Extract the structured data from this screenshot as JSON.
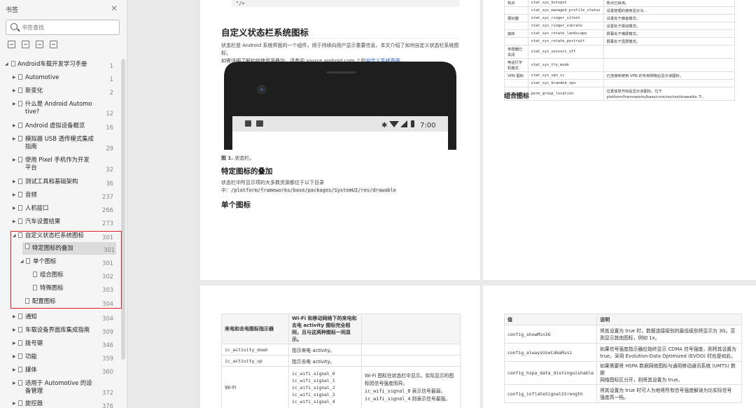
{
  "sidebar": {
    "title": "书签",
    "search_placeholder": "书签查找",
    "tree": [
      {
        "label": "Android车载开发学习手册",
        "page": "1"
      },
      {
        "label": "Automotive",
        "page": "1"
      },
      {
        "label": "新变化",
        "page": "2"
      },
      {
        "label": "什么是 Android Automo",
        "label2": "tive?",
        "page": "12"
      },
      {
        "label": "Android 虚拟设备概览",
        "page": "16"
      },
      {
        "label": "模拟器 USB 透传模式集成",
        "label2": "指南",
        "page": "29"
      },
      {
        "label": "使用 Pixel 手机作为开发",
        "label2": "平台",
        "page": "32"
      },
      {
        "label": "测试工具和基础架构",
        "page": "36"
      },
      {
        "label": "音频",
        "page": "237"
      },
      {
        "label": "人机接口",
        "page": "266"
      },
      {
        "label": "汽车设置结果",
        "page": "273"
      },
      {
        "label": "自定义状态栏系统图标",
        "page": "301"
      },
      {
        "label": "特定图标的叠加",
        "page": "301"
      },
      {
        "label": "单个图标",
        "page": "301"
      },
      {
        "label": "组合图标",
        "page": "302"
      },
      {
        "label": "特殊图标",
        "page": "303"
      },
      {
        "label": "配置图标",
        "page": "304"
      },
      {
        "label": "通知",
        "page": "304"
      },
      {
        "label": "车载设备界面库集成指南",
        "page": "309"
      },
      {
        "label": "拨号键",
        "page": "346"
      },
      {
        "label": "功能",
        "page": "359"
      },
      {
        "label": "媒体",
        "page": "360"
      },
      {
        "label": "适用于 Automotive 的设",
        "label2": "备管理",
        "page": "372"
      },
      {
        "label": "旋控器",
        "page": "376"
      }
    ]
  },
  "page1": {
    "code": "\"/>",
    "heading": "自定义状态栏系统图标",
    "intro1": "状态栏是 Android 系统界面的一个组件，用于持续向用户显示重要信息。本文介绍了如何自定义状态栏系统图标。",
    "intro2a": "如需详细了解如何使资源叠加，请参阅 source.android.com 上的",
    "intro2link": "自定义系统界面",
    "intro2b": "。",
    "status_time": "7:00",
    "caption_bold": "图 1.",
    "caption": " 状态栏。",
    "h_overlay": "特定图标的叠加",
    "overlay_text1": "状态栏中所显示项的大多数资源都位于以下目录",
    "overlay_text2a": "中：",
    "overlay_path": "/platform/frameworks/base/packages/SystemUI/res/drawable",
    "h_single": "单个图标"
  },
  "page2": {
    "rows": [
      [
        "热点",
        "stat_sys_hotspot",
        "热点已启用。"
      ],
      [
        "",
        "stat_sys_managed_profile_status",
        "设置管理的使用显示为…"
      ],
      [
        "振铃器",
        "stat_sys_ringer_silent",
        "设置处于静音模式。"
      ],
      [
        "",
        "stat_sys_ringer_vibrate",
        "设置处于振动模式。"
      ],
      [
        "旋转",
        "stat_sys_rotate_landscape",
        "屏幕处于横屏模式。"
      ],
      [
        "",
        "stat_sys_rotate_portrait",
        "屏幕处于竖屏模式。"
      ],
      [
        "传感器已关闭",
        "stat_sys_sensors_off",
        ""
      ],
      [
        "电话打字机模式",
        "stat_sys_tty_mode",
        ""
      ],
      [
        "VPN 图标",
        "stat_sys_vpn_ic",
        "已连接到使用 VPN 的专用网络后显示该图标。"
      ],
      [
        "",
        "stat_sys_branded_vpn",
        ""
      ],
      [
        "位置信息",
        "perm_group_location",
        "位置信息开启后显示该图标。位于 platform/frameworks/base/core/res/res/drawable 下。"
      ]
    ],
    "h_combo": "组合图标"
  },
  "page3": {
    "headers": [
      "来电和去电图标指示器",
      "Wi-Fi 和移动网络下的来电和去电 activity 图标完全相同，且与这两种图标一同显示。",
      ""
    ],
    "rows": [
      {
        "name": "ic_activity_down",
        "desc": "指示来电 activity。"
      },
      {
        "name": "ic_activity_up",
        "desc": "指示去电 activity。"
      }
    ],
    "wifi_label": "Wi-Fi",
    "wifi_icons": [
      "ic_wifi_signal_0",
      "ic_wifi_signal_1",
      "ic_wifi_signal_2",
      "ic_wifi_signal_3",
      "ic_wifi_signal_4"
    ],
    "wifi_desc1": "Wi-Fi 图标在状态栏中显示。实际显示的图标因信号强度而异。",
    "wifi_desc2a": "ic_wifi_signal_0",
    "wifi_desc2b": " 表示信号最弱，",
    "wifi_desc3a": "ic_wifi_signal_4",
    "wifi_desc3b": " 则表示信号最强。"
  },
  "page4": {
    "headers": [
      "值",
      "说明"
    ],
    "rows": [
      {
        "name": "config_showMin3G",
        "d1": "将其设置为 true 时，数据连接级别的最低级别将显示为 3G。否",
        "d2": "则显示其他图标，例如 1x。"
      },
      {
        "name": "config_alwaysUseCdmaRssi",
        "d1": "如果信号强度指示器应始终显示 CDMA 信号强度，则将其设置为",
        "d2": "true。采用 Evolution-Data Optimized (EVDO) 时也是如此。"
      },
      {
        "name": "config_hspa_data_distinguishable",
        "d1": "如果需要将 HSPA 数据网络图标与通用移动通讯系统 (UMTS) 数据",
        "d2": "网络图标区分开，则将其设置为 true。"
      },
      {
        "name": "config_inflateSignalStrength",
        "d1": "将其设置为 true 时可人为地将所有信号强度解读为比实际信号",
        "d2": "强度高一档。"
      }
    ]
  }
}
